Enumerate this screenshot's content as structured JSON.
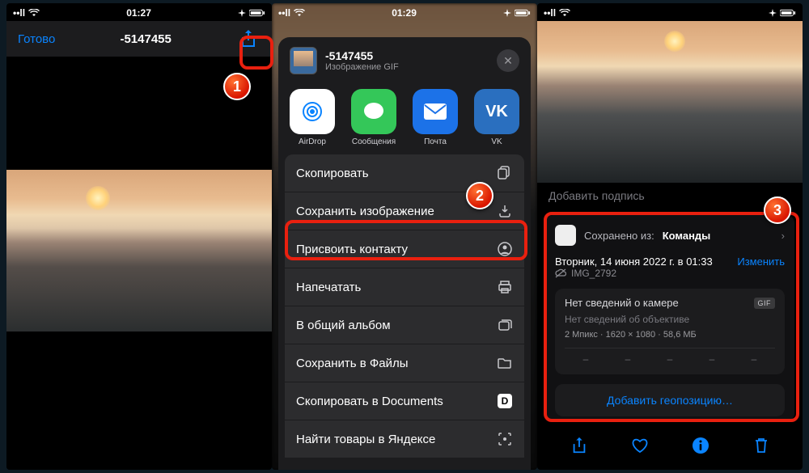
{
  "status": {
    "time1": "01:27",
    "time2": "01:29",
    "time3": "",
    "signal": "•ll",
    "wifi": "wifi"
  },
  "phone1": {
    "done": "Готово",
    "title": "-5147455"
  },
  "phone2": {
    "filename": "-5147455",
    "filetype": "Изображение GIF",
    "apps": [
      {
        "label": "AirDrop"
      },
      {
        "label": "Сообщения"
      },
      {
        "label": "Почта"
      },
      {
        "label": "VK"
      }
    ],
    "actions": [
      {
        "label": "Скопировать",
        "icon": "copy"
      },
      {
        "label": "Сохранить изображение",
        "icon": "download"
      },
      {
        "label": "Присвоить контакту",
        "icon": "contact"
      },
      {
        "label": "Напечатать",
        "icon": "print"
      },
      {
        "label": "В общий альбом",
        "icon": "shared-album"
      },
      {
        "label": "Сохранить в Файлы",
        "icon": "folder"
      },
      {
        "label": "Скопировать в Documents",
        "icon": "documents-app"
      },
      {
        "label": "Найти товары в Яндексе",
        "icon": "yandex-lens"
      }
    ]
  },
  "phone3": {
    "caption_placeholder": "Добавить подпись",
    "saved_prefix": "Сохранено из:",
    "saved_app": "Команды",
    "datetime": "Вторник, 14 июня 2022 г. в 01:33",
    "edit": "Изменить",
    "filename": "IMG_2792",
    "no_camera": "Нет сведений о камере",
    "badge": "GIF",
    "no_lens": "Нет сведений об объективе",
    "meta": "2 Мпикс · 1620 × 1080 · 58,6 МБ",
    "dash": "–",
    "add_geo": "Добавить геопозицию…"
  },
  "annot": {
    "n1": "1",
    "n2": "2",
    "n3": "3"
  }
}
